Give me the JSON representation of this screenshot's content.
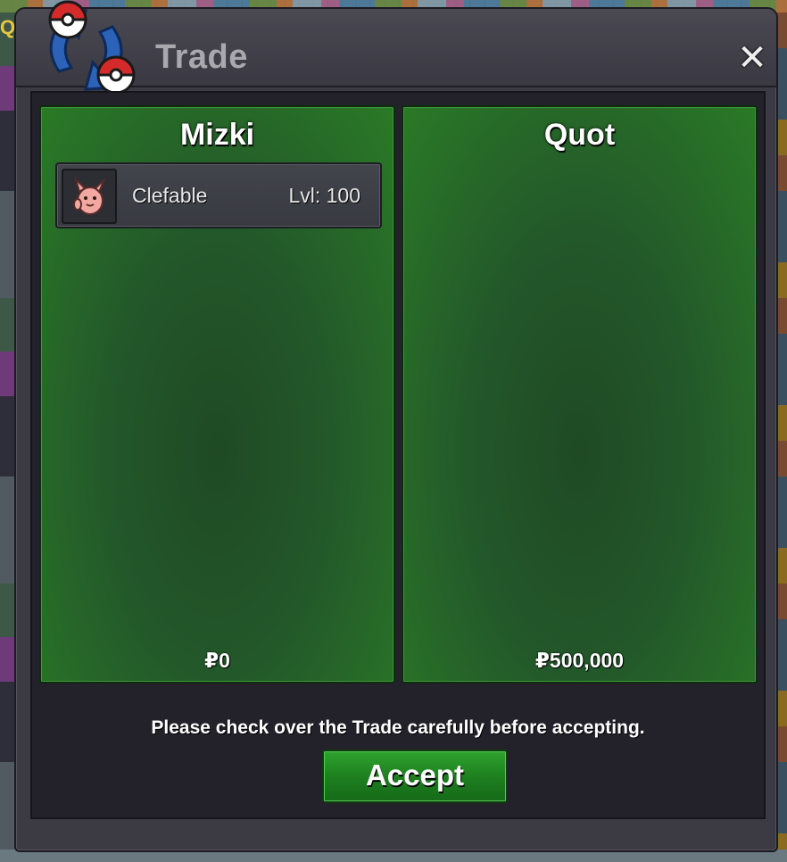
{
  "window": {
    "title": "Trade",
    "close_glyph": "✕"
  },
  "background": {
    "partial_text": "Qu"
  },
  "trade": {
    "left_player": {
      "name": "Mizki",
      "money": "₽0",
      "items": [
        {
          "name": "Clefable",
          "level": "Lvl: 100",
          "icon": "clefable-sprite"
        }
      ]
    },
    "right_player": {
      "name": "Quot",
      "money": "₽500,000",
      "items": []
    },
    "notice": "Please check over the Trade carefully before accepting.",
    "accept_label": "Accept"
  },
  "colors": {
    "panel_green": "#2a7a26",
    "accept_green": "#1d7d1f",
    "window_bg": "#3c3b44"
  }
}
